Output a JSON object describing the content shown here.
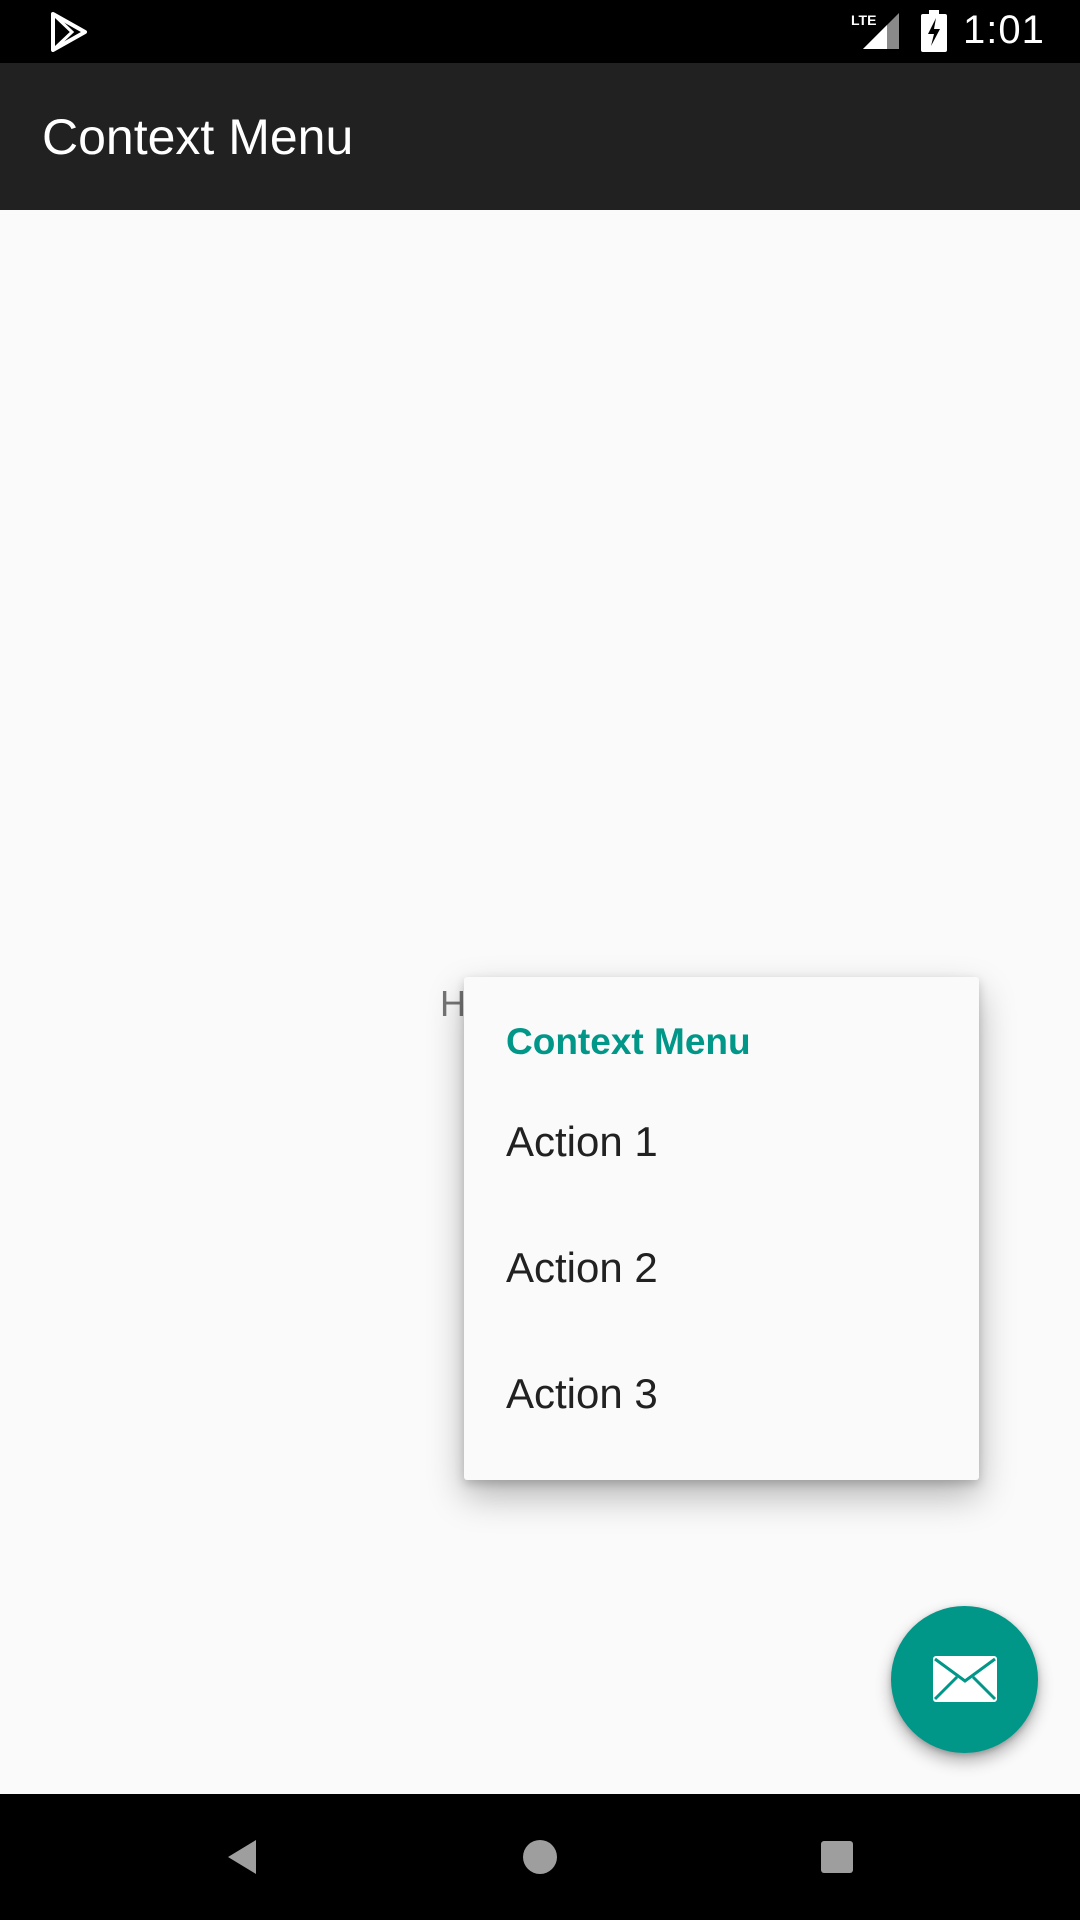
{
  "status_bar": {
    "time": "1:01",
    "network": "LTE",
    "icons": [
      "play-store-icon",
      "lte-signal-icon",
      "battery-charging-icon"
    ]
  },
  "app_bar": {
    "title": "Context Menu"
  },
  "content": {
    "partial_text": "H"
  },
  "context_menu": {
    "title": "Context Menu",
    "items": [
      {
        "label": "Action 1"
      },
      {
        "label": "Action 2"
      },
      {
        "label": "Action 3"
      }
    ],
    "accent_color": "#009688"
  },
  "fab": {
    "icon": "email-icon",
    "color": "#009688"
  },
  "nav_bar": {
    "buttons": [
      "back-icon",
      "home-icon",
      "recents-icon"
    ]
  }
}
